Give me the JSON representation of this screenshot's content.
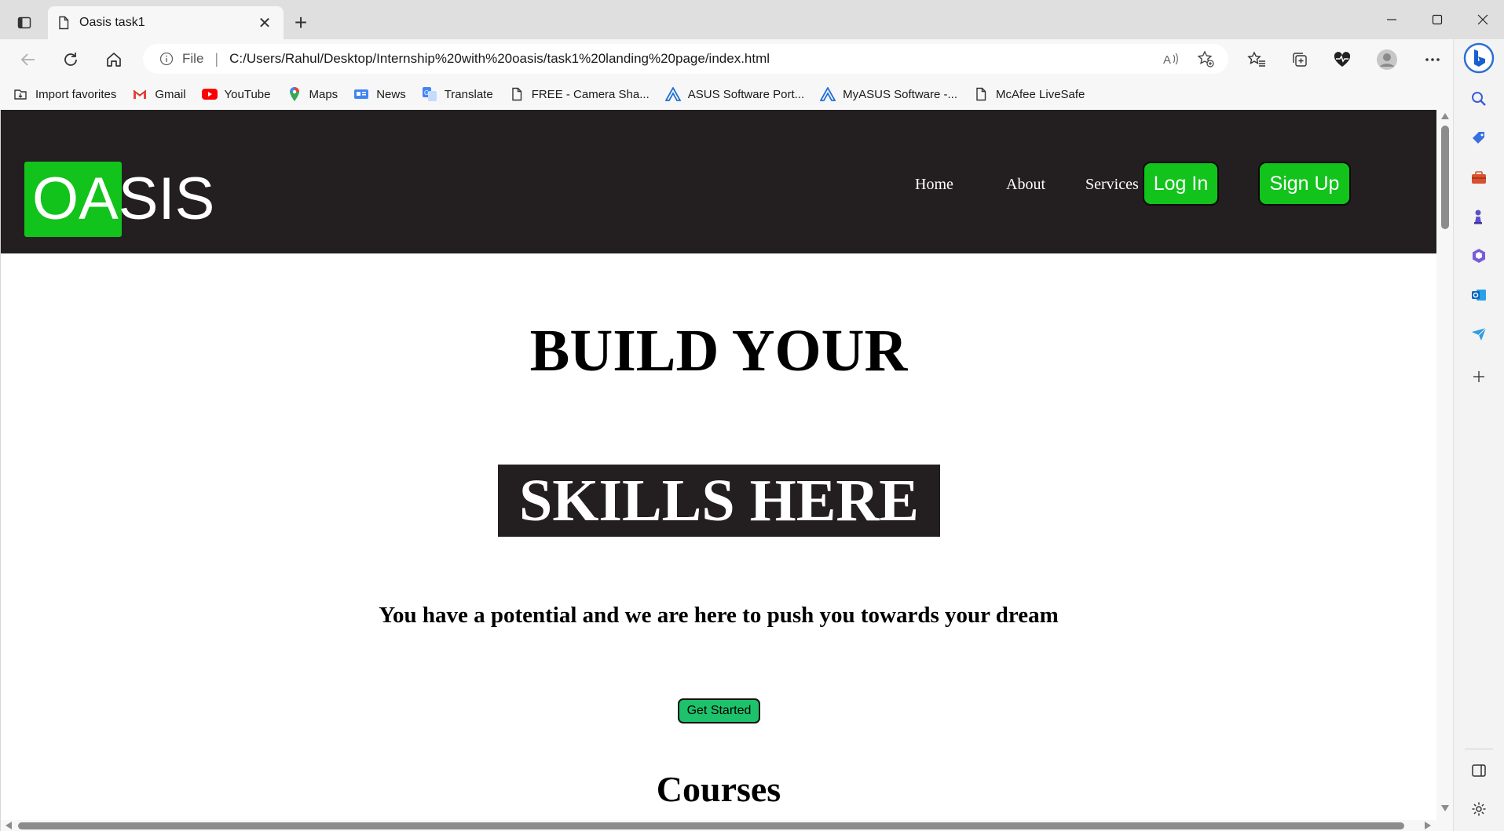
{
  "browser": {
    "tab": {
      "title": "Oasis task1",
      "close_glyph": "✕",
      "icon": "page-icon"
    },
    "new_tab_glyph": "+",
    "address": {
      "scheme_label": "File",
      "separator": "|",
      "url": "C:/Users/Rahul/Desktop/Internship%20with%20oasis/task1%20landing%20page/index.html"
    },
    "favorites": [
      {
        "label": "Import favorites",
        "icon": "import-favorites-icon"
      },
      {
        "label": "Gmail",
        "icon": "gmail-icon",
        "color": "#ea4335"
      },
      {
        "label": "YouTube",
        "icon": "youtube-icon",
        "color": "#ff0000"
      },
      {
        "label": "Maps",
        "icon": "maps-icon",
        "color": "#34a853"
      },
      {
        "label": "News",
        "icon": "news-icon",
        "color": "#4285f4"
      },
      {
        "label": "Translate",
        "icon": "translate-icon",
        "color": "#4285f4"
      },
      {
        "label": "FREE - Camera Sha...",
        "icon": "page-icon"
      },
      {
        "label": "ASUS Software Port...",
        "icon": "asus-icon",
        "color": "#1f6fd6"
      },
      {
        "label": "MyASUS Software -...",
        "icon": "asus-icon",
        "color": "#1f6fd6"
      },
      {
        "label": "McAfee LiveSafe",
        "icon": "page-icon"
      }
    ]
  },
  "site": {
    "logo_text": "OASIS",
    "accent_color": "#12c31b",
    "header_bg": "#231f20",
    "nav": {
      "home": "Home",
      "about": "About",
      "services": "Services",
      "login": "Log In",
      "signup": "Sign Up"
    },
    "hero": {
      "line1": "BUILD YOUR",
      "line2": "SKILLS HERE",
      "tagline": "You have a potential and we are here to push you towards your dream",
      "cta": "Get Started",
      "cta_color": "#1ec26b"
    },
    "section_title": "Courses"
  }
}
